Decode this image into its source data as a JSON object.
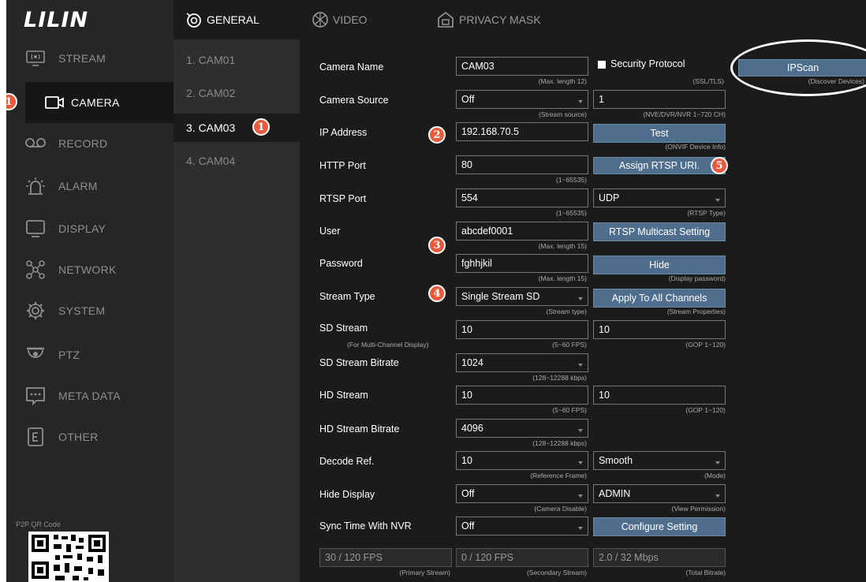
{
  "logo": "LILIN",
  "sidebar": {
    "items": [
      {
        "label": "STREAM",
        "icon": "stream-icon"
      },
      {
        "label": "CAMERA",
        "icon": "camera-icon"
      },
      {
        "label": "RECORD",
        "icon": "record-icon"
      },
      {
        "label": "ALARM",
        "icon": "alarm-icon"
      },
      {
        "label": "DISPLAY",
        "icon": "display-icon"
      },
      {
        "label": "NETWORK",
        "icon": "network-icon"
      },
      {
        "label": "SYSTEM",
        "icon": "gear-icon"
      },
      {
        "label": "PTZ",
        "icon": "ptz-icon"
      },
      {
        "label": "META DATA",
        "icon": "metadata-icon"
      },
      {
        "label": "OTHER",
        "icon": "other-icon"
      }
    ],
    "p2p_label": "P2P QR Code"
  },
  "tabs": {
    "general": "GENERAL",
    "video": "VIDEO",
    "privacy": "PRIVACY MASK"
  },
  "cameras": [
    "1. CAM01",
    "2. CAM02",
    "3. CAM03",
    "4. CAM04"
  ],
  "badges": {
    "one": "1",
    "two": "2",
    "three": "3",
    "four": "4",
    "five": "5"
  },
  "form": {
    "camera_name": {
      "label": "Camera Name",
      "value": "CAM03",
      "hint": "(Max. length 12)"
    },
    "security": {
      "label": "Security Protocol",
      "hint": "(SSL/TLS)"
    },
    "ipscan": {
      "label": "IPScan",
      "hint": "(Discover Devices)"
    },
    "camera_source": {
      "label": "Camera Source",
      "value": "Off",
      "hint": "(Stream source)",
      "channel": "1",
      "channel_hint": "(NVE/DVR/NVR 1~720 CH)"
    },
    "ip": {
      "label": "IP Address",
      "value": "192.168.70.5",
      "test": "Test",
      "test_hint": "(ONVIF Device Info)"
    },
    "http": {
      "label": "HTTP Port",
      "value": "80",
      "hint": "(1~65535)",
      "assign": "Assign RTSP URI."
    },
    "rtsp": {
      "label": "RTSP Port",
      "value": "554",
      "hint": "(1~65535)",
      "type": "UDP",
      "type_hint": "(RTSP Type)"
    },
    "user": {
      "label": "User",
      "value": "abcdef0001",
      "hint": "(Max. length 15)",
      "multicast": "RTSP Multicast Setting"
    },
    "password": {
      "label": "Password",
      "value": "fghhjkil",
      "hint": "(Max. length 15)",
      "hide": "Hide",
      "hide_hint": "(Display password)"
    },
    "stream_type": {
      "label": "Stream Type",
      "value": "Single Stream SD",
      "hint": "(Stream type)",
      "apply": "Apply To All Channels",
      "apply_hint": "(Stream Properties)"
    },
    "sd_stream": {
      "label": "SD Stream",
      "sub": "(For Multi-Channel Display)",
      "fps": "10",
      "fps_hint": "(5~60 FPS)",
      "gop": "10",
      "gop_hint": "(GOP 1~120)"
    },
    "sd_bitrate": {
      "label": "SD Stream Bitrate",
      "value": "1024",
      "hint": "(128~12288 kbps)"
    },
    "hd_stream": {
      "label": "HD Stream",
      "fps": "10",
      "fps_hint": "(5~60 FPS)",
      "gop": "10",
      "gop_hint": "(GOP 1~120)"
    },
    "hd_bitrate": {
      "label": "HD Stream Bitrate",
      "value": "4096",
      "hint": "(128~12288 kbps)"
    },
    "decode": {
      "label": "Decode Ref.",
      "value": "10",
      "hint": "(Reference Frame)",
      "mode": "Smooth",
      "mode_hint": "(Mode)"
    },
    "hide_display": {
      "label": "Hide Display",
      "value": "Off",
      "hint": "(Camera Disable)",
      "perm": "ADMIN",
      "perm_hint": "(View Permission)"
    },
    "sync": {
      "label": "Sync Time With NVR",
      "value": "Off",
      "configure": "Configure Setting"
    },
    "stats": {
      "primary": "30 / 120 FPS",
      "primary_hint": "(Primary Stream)",
      "secondary": "0 / 120 FPS",
      "secondary_hint": "(Secondary Stream)",
      "total": "2.0 / 32 Mbps",
      "total_hint": "(Total Bitrate)"
    }
  }
}
